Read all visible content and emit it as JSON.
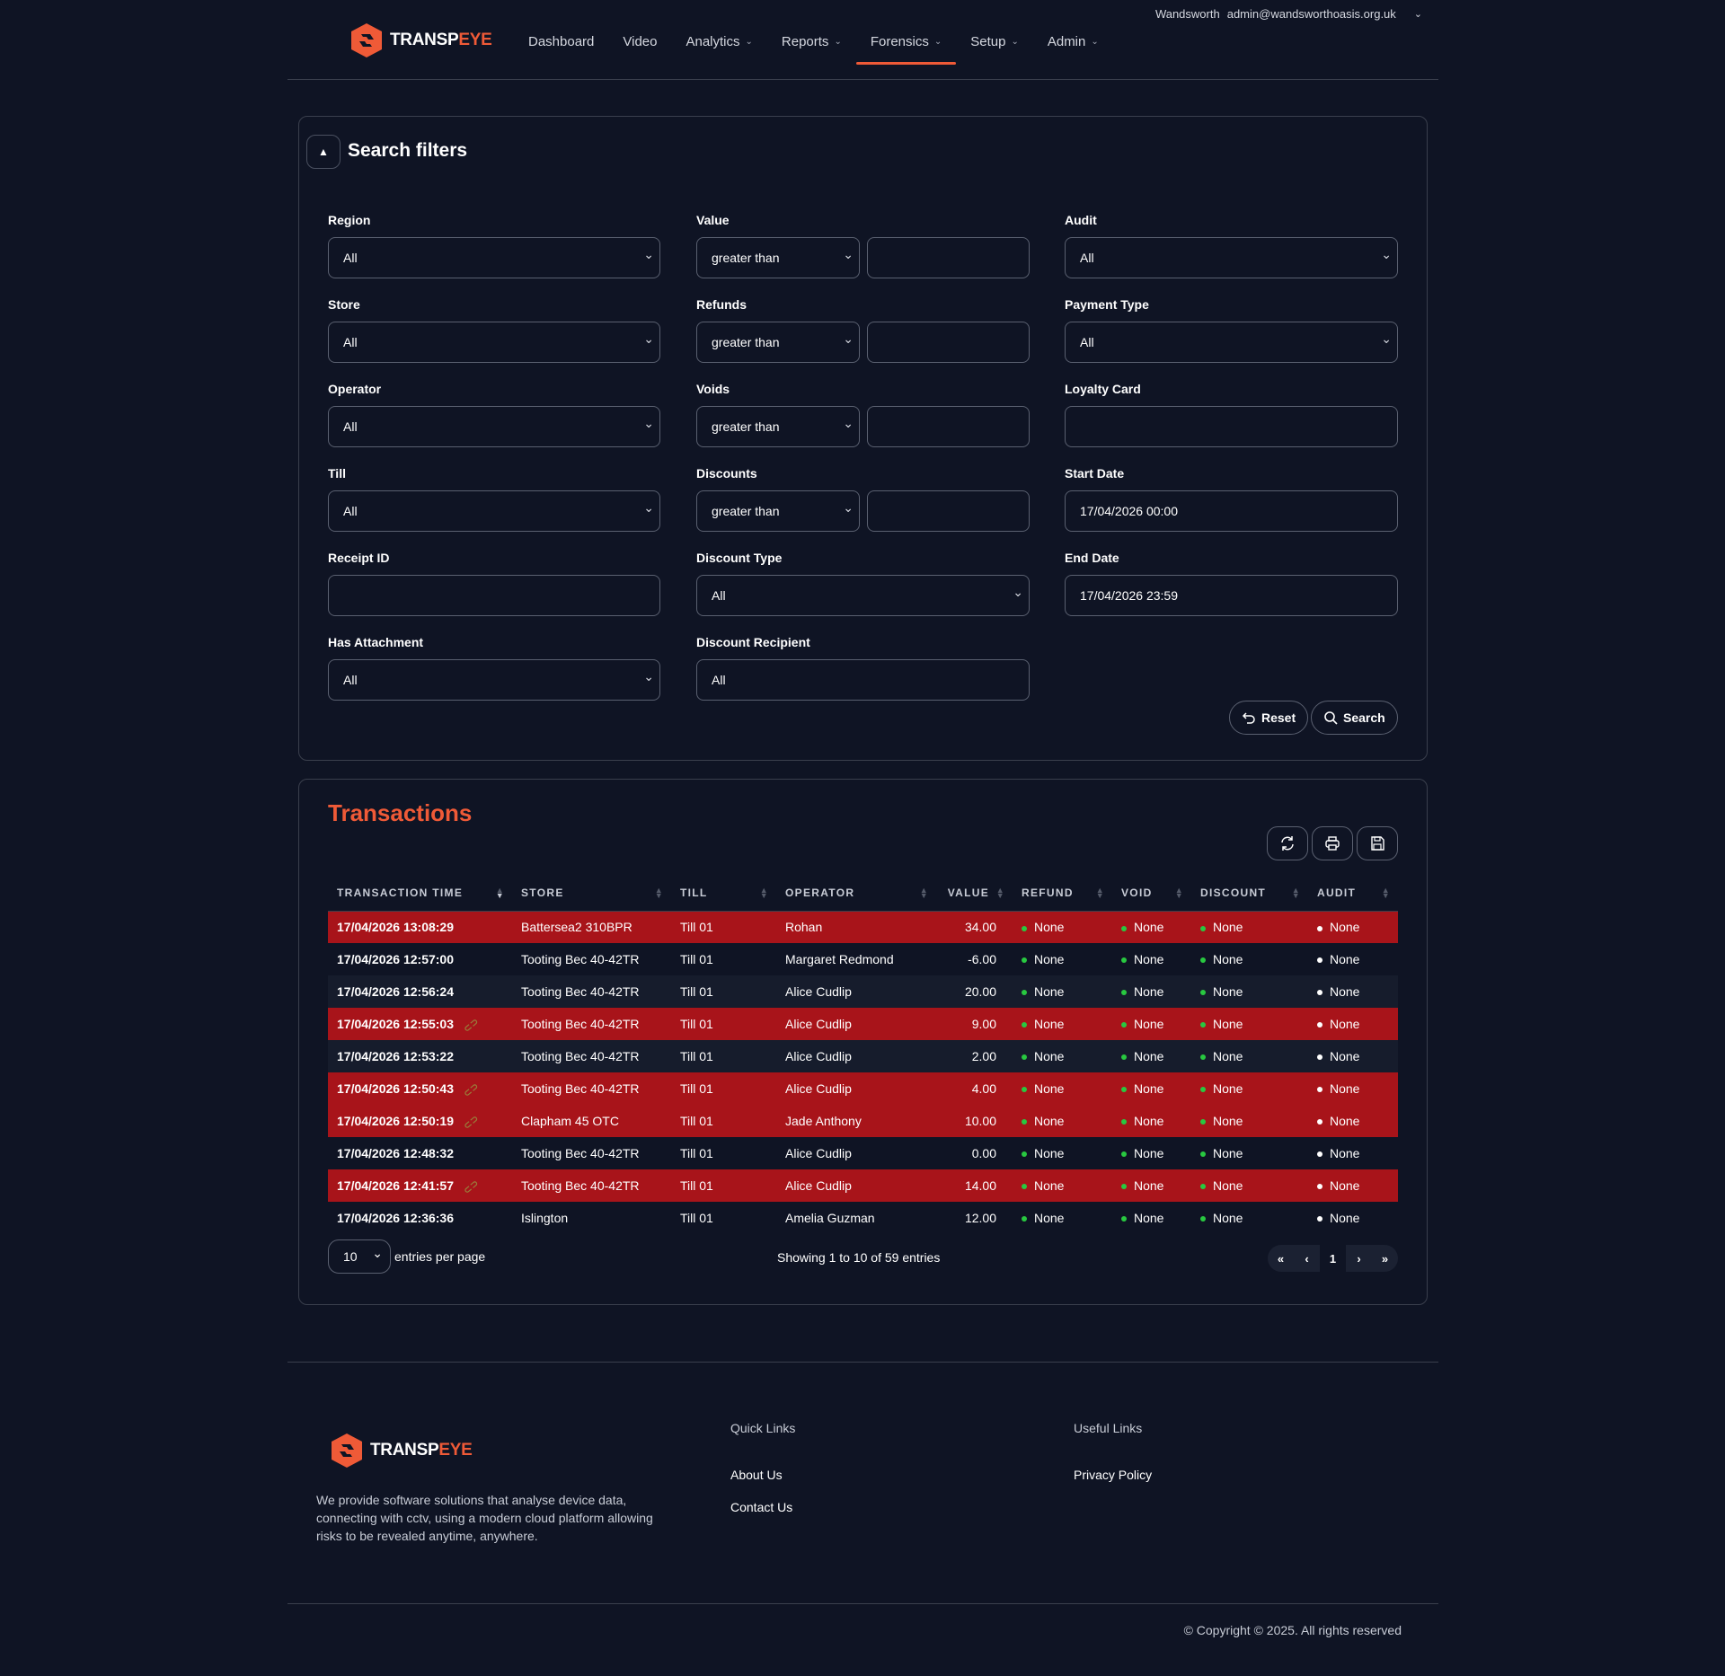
{
  "header": {
    "account_org": "Wandsworth",
    "account_email": "admin@wandsworthoasis.org.uk",
    "logo_prefix": "TRANSP",
    "logo_suffix": "EYE",
    "nav": [
      {
        "label": "Dashboard",
        "dropdown": false
      },
      {
        "label": "Video",
        "dropdown": false
      },
      {
        "label": "Analytics",
        "dropdown": true
      },
      {
        "label": "Reports",
        "dropdown": true
      },
      {
        "label": "Forensics",
        "dropdown": true,
        "active": true
      },
      {
        "label": "Setup",
        "dropdown": true
      },
      {
        "label": "Admin",
        "dropdown": true
      }
    ]
  },
  "filters": {
    "title": "Search filters",
    "region": {
      "label": "Region",
      "value": "All"
    },
    "store": {
      "label": "Store",
      "value": "All"
    },
    "operator": {
      "label": "Operator",
      "value": "All"
    },
    "till": {
      "label": "Till",
      "value": "All"
    },
    "receipt_id": {
      "label": "Receipt ID",
      "value": ""
    },
    "has_attachment": {
      "label": "Has Attachment",
      "value": "All"
    },
    "value": {
      "label": "Value",
      "comparator": "greater than",
      "amount": ""
    },
    "refunds": {
      "label": "Refunds",
      "comparator": "greater than",
      "amount": ""
    },
    "voids": {
      "label": "Voids",
      "comparator": "greater than",
      "amount": ""
    },
    "discounts": {
      "label": "Discounts",
      "comparator": "greater than",
      "amount": ""
    },
    "discount_type": {
      "label": "Discount Type",
      "value": "All"
    },
    "discount_recipient": {
      "label": "Discount Recipient",
      "value": "All"
    },
    "audit": {
      "label": "Audit",
      "value": "All"
    },
    "payment_type": {
      "label": "Payment Type",
      "value": "All"
    },
    "loyalty_card": {
      "label": "Loyalty Card",
      "value": ""
    },
    "start_date": {
      "label": "Start Date",
      "value": "17/04/2026 00:00"
    },
    "end_date": {
      "label": "End Date",
      "value": "17/04/2026 23:59"
    },
    "reset_label": "Reset",
    "search_label": "Search"
  },
  "transactions": {
    "title": "Transactions",
    "columns": [
      "TRANSACTION TIME",
      "STORE",
      "TILL",
      "OPERATOR",
      "VALUE",
      "REFUND",
      "VOID",
      "DISCOUNT",
      "AUDIT"
    ],
    "rows": [
      {
        "time": "17/04/2026 13:08:29",
        "store": "Battersea2 310BPR",
        "till": "Till 01",
        "operator": "Rohan",
        "value": "34.00",
        "refund": "None",
        "void": "None",
        "discount": "None",
        "audit": "None",
        "flagged": true,
        "attachment": false
      },
      {
        "time": "17/04/2026 12:57:00",
        "store": "Tooting Bec 40-42TR",
        "till": "Till 01",
        "operator": "Margaret Redmond",
        "value": "-6.00",
        "refund": "None",
        "void": "None",
        "discount": "None",
        "audit": "None",
        "flagged": false,
        "attachment": false
      },
      {
        "time": "17/04/2026 12:56:24",
        "store": "Tooting Bec 40-42TR",
        "till": "Till 01",
        "operator": "Alice Cudlip",
        "value": "20.00",
        "refund": "None",
        "void": "None",
        "discount": "None",
        "audit": "None",
        "flagged": false,
        "attachment": false
      },
      {
        "time": "17/04/2026 12:55:03",
        "store": "Tooting Bec 40-42TR",
        "till": "Till 01",
        "operator": "Alice Cudlip",
        "value": "9.00",
        "refund": "None",
        "void": "None",
        "discount": "None",
        "audit": "None",
        "flagged": true,
        "attachment": true
      },
      {
        "time": "17/04/2026 12:53:22",
        "store": "Tooting Bec 40-42TR",
        "till": "Till 01",
        "operator": "Alice Cudlip",
        "value": "2.00",
        "refund": "None",
        "void": "None",
        "discount": "None",
        "audit": "None",
        "flagged": false,
        "attachment": false
      },
      {
        "time": "17/04/2026 12:50:43",
        "store": "Tooting Bec 40-42TR",
        "till": "Till 01",
        "operator": "Alice Cudlip",
        "value": "4.00",
        "refund": "None",
        "void": "None",
        "discount": "None",
        "audit": "None",
        "flagged": true,
        "attachment": true
      },
      {
        "time": "17/04/2026 12:50:19",
        "store": "Clapham 45 OTC",
        "till": "Till 01",
        "operator": "Jade Anthony",
        "value": "10.00",
        "refund": "None",
        "void": "None",
        "discount": "None",
        "audit": "None",
        "flagged": true,
        "attachment": true
      },
      {
        "time": "17/04/2026 12:48:32",
        "store": "Tooting Bec 40-42TR",
        "till": "Till 01",
        "operator": "Alice Cudlip",
        "value": "0.00",
        "refund": "None",
        "void": "None",
        "discount": "None",
        "audit": "None",
        "flagged": false,
        "attachment": false
      },
      {
        "time": "17/04/2026 12:41:57",
        "store": "Tooting Bec 40-42TR",
        "till": "Till 01",
        "operator": "Alice Cudlip",
        "value": "14.00",
        "refund": "None",
        "void": "None",
        "discount": "None",
        "audit": "None",
        "flagged": true,
        "attachment": true
      },
      {
        "time": "17/04/2026 12:36:36",
        "store": "Islington",
        "till": "Till 01",
        "operator": "Amelia Guzman",
        "value": "12.00",
        "refund": "None",
        "void": "None",
        "discount": "None",
        "audit": "None",
        "flagged": false,
        "attachment": false
      }
    ],
    "per_page": "10",
    "per_page_label": "entries per page",
    "showing": "Showing 1 to 10 of 59 entries",
    "pagination": [
      "«",
      "‹",
      "1",
      "›",
      "»"
    ],
    "current_page": "1"
  },
  "footer": {
    "description": "We provide software solutions that analyse device data, connecting with cctv, using a modern cloud platform allowing risks to be revealed anytime, anywhere.",
    "quick_links_title": "Quick Links",
    "quick_links": [
      "About Us",
      "Contact Us"
    ],
    "useful_links_title": "Useful Links",
    "useful_links": [
      "Privacy Policy"
    ],
    "copyright": "© Copyright © 2025. All rights reserved"
  },
  "colors": {
    "background": "#0f1424",
    "accent": "#ef5a37",
    "flagged_row": "#a8141a",
    "status_green": "#28c840"
  }
}
